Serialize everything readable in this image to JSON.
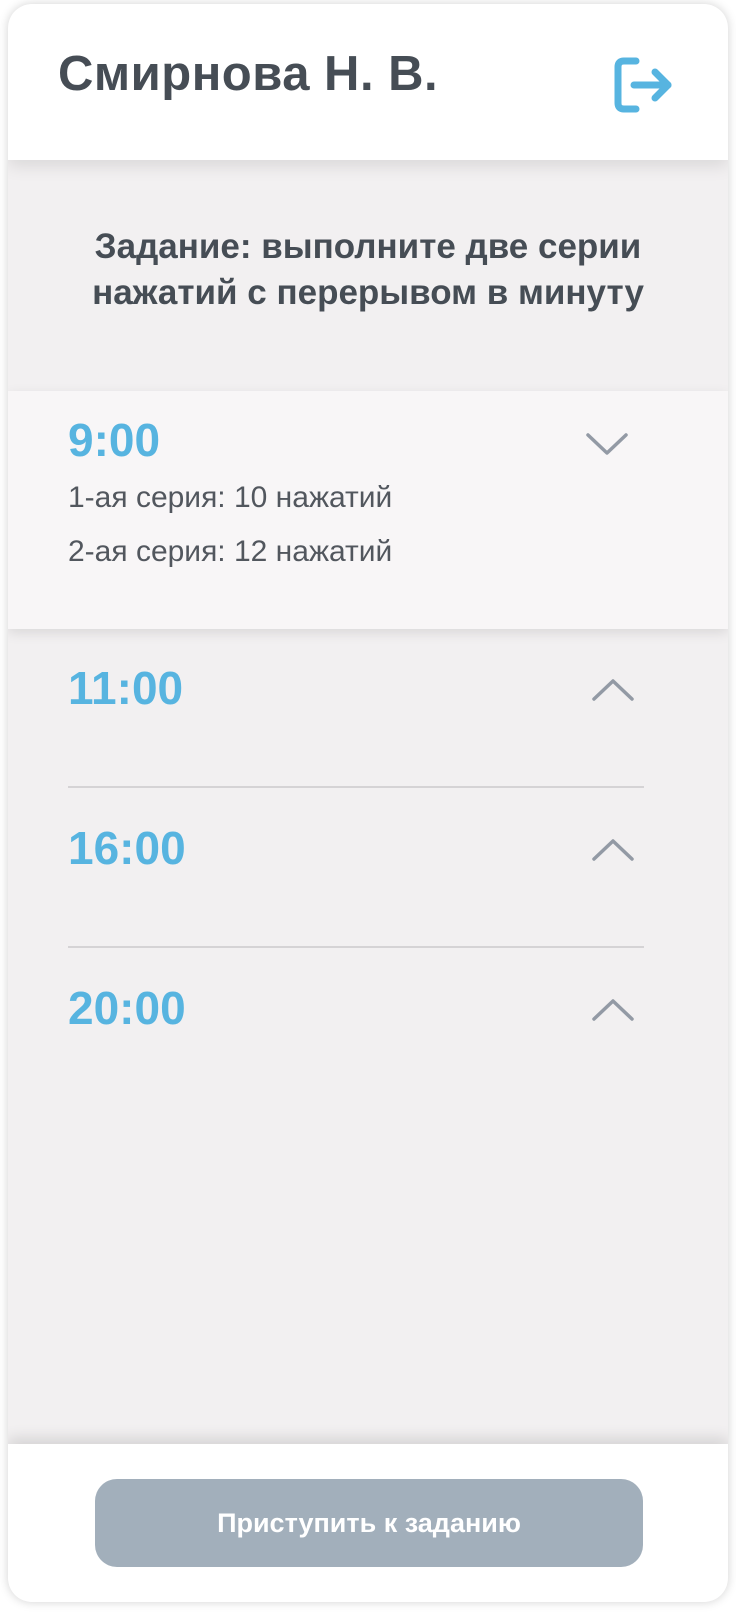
{
  "header": {
    "user_name": "Смирнова Н. В.",
    "logout_icon": "logout-icon"
  },
  "task": {
    "line1": "Задание: выполните две серии",
    "line2": "нажатий с перерывом в минуту"
  },
  "schedule": [
    {
      "time": "9:00",
      "expanded": true,
      "series": [
        "1-ая серия: 10 нажатий",
        "2-ая серия: 12 нажатий"
      ]
    },
    {
      "time": "11:00",
      "expanded": false
    },
    {
      "time": "16:00",
      "expanded": false
    },
    {
      "time": "20:00",
      "expanded": false
    }
  ],
  "footer": {
    "start_button": "Приступить к заданию"
  },
  "colors": {
    "accent": "#57b4e0",
    "text": "#464d55",
    "button_disabled": "#a2afbb",
    "background": "#f2f0f1"
  }
}
